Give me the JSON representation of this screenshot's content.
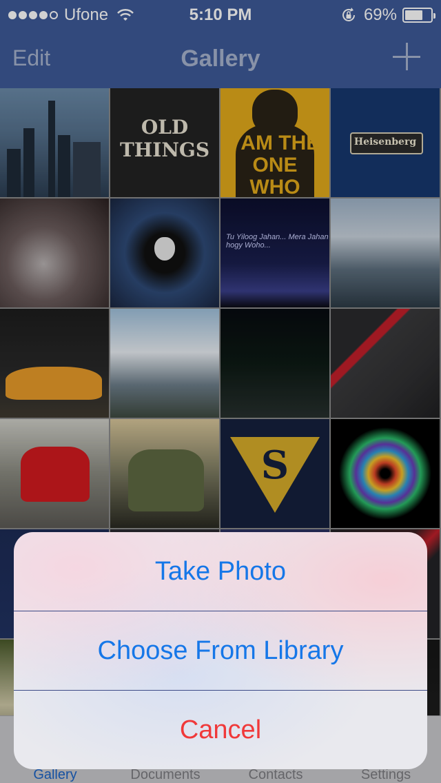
{
  "status_bar": {
    "carrier": "Ufone",
    "time": "5:10 PM",
    "battery_percent": "69%",
    "battery_level": 0.69,
    "signal_bars_filled": 4,
    "signal_bars_total": 5
  },
  "nav": {
    "edit_label": "Edit",
    "title": "Gallery",
    "add_icon": "plus-icon"
  },
  "tiles": {
    "old_things": "OLD THINGS",
    "knocks": "I AM THE ONE WHO KNOCKS",
    "heisenberg": "Heisenberg",
    "quote": "Tu Yiloog Jahan... Mera Jahan hogy Woho...",
    "superman": "S"
  },
  "action_sheet": {
    "take_photo": "Take Photo",
    "choose_library": "Choose From Library",
    "cancel": "Cancel"
  },
  "tab_bar": {
    "tabs": [
      {
        "label": "Gallery",
        "active": true
      },
      {
        "label": "Documents",
        "active": false
      },
      {
        "label": "Contacts",
        "active": false
      },
      {
        "label": "Settings",
        "active": false
      }
    ]
  },
  "colors": {
    "nav_bar": "#3d5a98",
    "accent_blue": "#1677e8",
    "destructive_red": "#f0393a"
  }
}
